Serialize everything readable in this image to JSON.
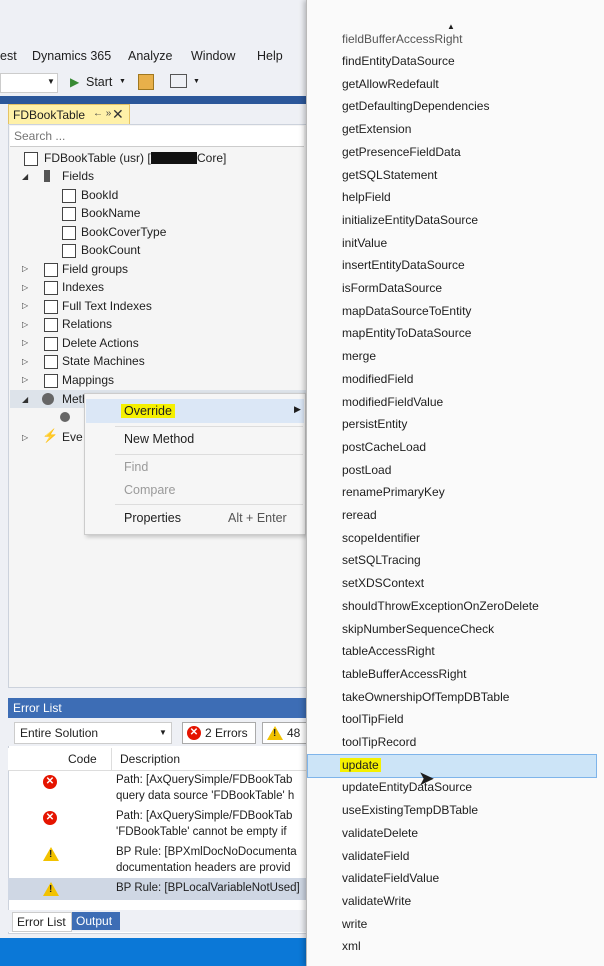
{
  "menu": [
    "est",
    "Dynamics 365",
    "Analyze",
    "Window",
    "Help"
  ],
  "toolbar": {
    "start_label": "Start"
  },
  "doc_tab": {
    "title": "FDBookTable",
    "pin": "← »",
    "close": "✕"
  },
  "search": {
    "placeholder": "Search ..."
  },
  "tree": {
    "root": "FDBookTable (usr) [",
    "root_tail": "Core]",
    "fields_label": "Fields",
    "fields": [
      "BookId",
      "BookName",
      "BookCoverType",
      "BookCount"
    ],
    "nodes": [
      "Field groups",
      "Indexes",
      "Full Text Indexes",
      "Relations",
      "Delete Actions",
      "State Machines",
      "Mappings"
    ],
    "methods": "Meth",
    "events": "Eve"
  },
  "context_menu": {
    "override": "Override",
    "new_method": "New Method",
    "find": "Find",
    "compare": "Compare",
    "properties": "Properties",
    "properties_shortcut": "Alt + Enter"
  },
  "error_list": {
    "title": "Error List",
    "scope": "Entire Solution",
    "errors_label": "2 Errors",
    "warnings_count": "48",
    "col_code": "Code",
    "col_desc": "Description",
    "rows": [
      {
        "type": "error",
        "line1": "Path: [AxQuerySimple/FDBookTab",
        "line2": "query data source 'FDBookTable' h"
      },
      {
        "type": "error",
        "line1": "Path: [AxQuerySimple/FDBookTab",
        "line2": "'FDBookTable' cannot be empty if"
      },
      {
        "type": "warning",
        "line1": "BP Rule: [BPXmlDocNoDocumenta",
        "line2": "documentation headers are provid"
      },
      {
        "type": "warning",
        "line1": "BP Rule: [BPLocalVariableNotUsed]"
      }
    ],
    "tab_error": "Error List",
    "tab_output": "Output"
  },
  "dropdown": {
    "partial_top": "fieldBufferAccessRight",
    "items": [
      "findEntityDataSource",
      "getAllowRedefault",
      "getDefaultingDependencies",
      "getExtension",
      "getPresenceFieldData",
      "getSQLStatement",
      "helpField",
      "initializeEntityDataSource",
      "initValue",
      "insertEntityDataSource",
      "isFormDataSource",
      "mapDataSourceToEntity",
      "mapEntityToDataSource",
      "merge",
      "modifiedField",
      "modifiedFieldValue",
      "persistEntity",
      "postCacheLoad",
      "postLoad",
      "renamePrimaryKey",
      "reread",
      "scopeIdentifier",
      "setSQLTracing",
      "setXDSContext",
      "shouldThrowExceptionOnZeroDelete",
      "skipNumberSequenceCheck",
      "tableAccessRight",
      "tableBufferAccessRight",
      "takeOwnershipOfTempDBTable",
      "toolTipField",
      "toolTipRecord",
      "update",
      "updateEntityDataSource",
      "useExistingTempDBTable",
      "validateDelete",
      "validateField",
      "validateFieldValue",
      "validateWrite",
      "write",
      "xml"
    ],
    "selected": "update"
  },
  "colors": {
    "accent": "#2b579a",
    "highlight": "#f5f000",
    "selection": "#cce4f7",
    "error": "#e51400",
    "warning": "#f2c200"
  }
}
